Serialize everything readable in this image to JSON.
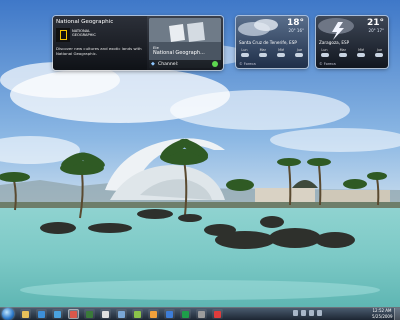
{
  "gadgets": {
    "natgeo": {
      "title": "National Geographic",
      "logo_text": "NATIONAL GEOGRAPHIC",
      "description": "Discover new cultures and exotic lands with National Geographic.",
      "photo_tag_small": "Ele",
      "photo_tag_big": "National Geograph...",
      "channel_label": "Channel:"
    },
    "weather1": {
      "temp": "18°",
      "range": "20° 16°",
      "city": "Santa Cruz de Tenerife, ESP",
      "days": [
        "Lun",
        "Mar",
        "Mié",
        "Jue"
      ],
      "source": "© Foreca"
    },
    "weather2": {
      "temp": "21°",
      "range": "20° 17°",
      "city": "Zaragoza, ESP",
      "days": [
        "Lun",
        "Mar",
        "Mié",
        "Jue"
      ],
      "source": "© Foreca"
    }
  },
  "taskbar": {
    "pinned": [
      {
        "name": "explorer",
        "color": "#e8c15a"
      },
      {
        "name": "media-player",
        "color": "#3d8fd8"
      },
      {
        "name": "internet-explorer",
        "color": "#4aa3e0"
      },
      {
        "name": "program-1",
        "color": "#d9574a"
      },
      {
        "name": "program-2",
        "color": "#3a7a3a"
      },
      {
        "name": "program-3",
        "color": "#e0e0e0"
      },
      {
        "name": "program-4",
        "color": "#7aa7d6"
      },
      {
        "name": "program-5",
        "color": "#8bc34a"
      },
      {
        "name": "program-6",
        "color": "#f2a13b"
      },
      {
        "name": "program-7",
        "color": "#3d7dd8"
      },
      {
        "name": "program-8",
        "color": "#1e9e4a"
      },
      {
        "name": "program-9",
        "color": "#9c9c9c"
      },
      {
        "name": "program-10",
        "color": "#e03c3c"
      }
    ],
    "active_index": 3,
    "clock_time": "12:52 AM",
    "clock_date": "5/25/2009"
  }
}
